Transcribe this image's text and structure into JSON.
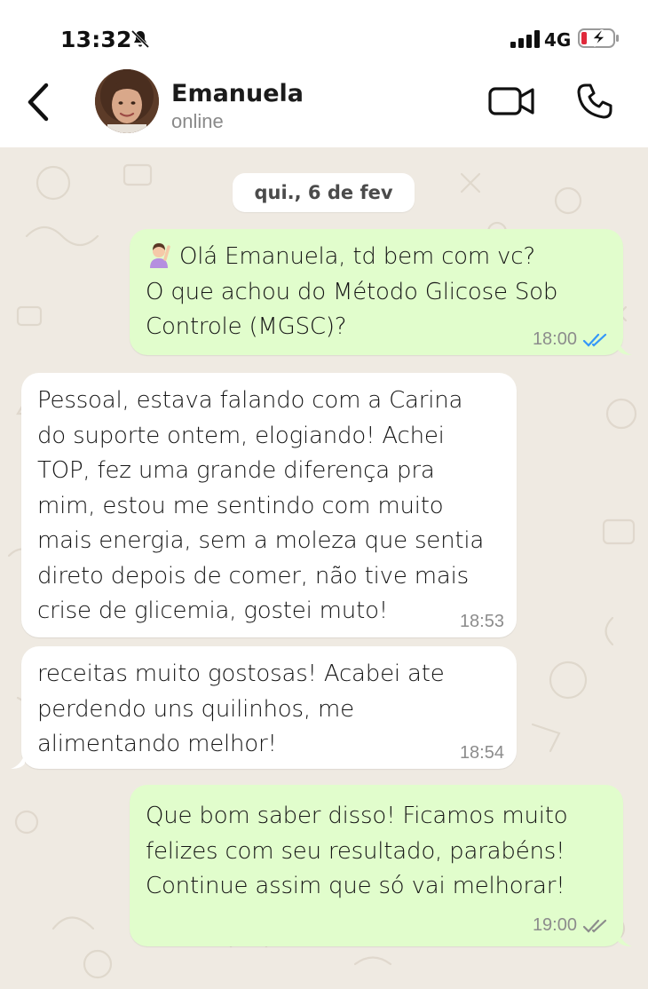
{
  "status_bar": {
    "time": "13:32",
    "network": "4G",
    "icons": [
      "bell-off-icon",
      "signal-icon",
      "battery-charging-icon"
    ]
  },
  "header": {
    "contact_name": "Emanuela",
    "contact_status": "online",
    "icons": [
      "back-arrow-icon",
      "video-call-icon",
      "phone-icon"
    ]
  },
  "chat": {
    "date_separator": "qui., 6 de fev",
    "messages": [
      {
        "direction": "outgoing",
        "emoji": "woman-raising-hand",
        "lines": [
          "Olá Emanuela, td bem com vc?",
          "O que achou do Método Glicose Sob",
          "Controle (MGSC)?"
        ],
        "time": "18:00",
        "status": "read",
        "tick_color": "#3497f9"
      },
      {
        "direction": "incoming",
        "lines": [
          "Pessoal, estava falando com a Carina",
          "do suporte ontem, elogiando! Achei",
          "TOP, fez uma grande diferença pra",
          "mim, estou me sentindo com muito",
          "mais energia, sem a moleza que sentia",
          "direto depois de comer, não tive mais",
          "crise de glicemia, gostei muto!"
        ],
        "time": "18:53"
      },
      {
        "direction": "incoming",
        "lines": [
          "receitas muito gostosas! Acabei ate",
          "perdendo uns quilinhos, me",
          "alimentando melhor!"
        ],
        "time": "18:54"
      },
      {
        "direction": "outgoing",
        "lines": [
          "Que bom saber disso! Ficamos muito",
          "felizes com seu resultado, parabéns!",
          "Continue assim que só vai melhorar!"
        ],
        "time": "19:00",
        "status": "delivered",
        "tick_color": "#8c8c8c"
      }
    ]
  },
  "colors": {
    "chat_background": "#efeae2",
    "outgoing_bubble": "#e1fdcc",
    "incoming_bubble": "#ffffff",
    "header_background": "#ffffff"
  }
}
